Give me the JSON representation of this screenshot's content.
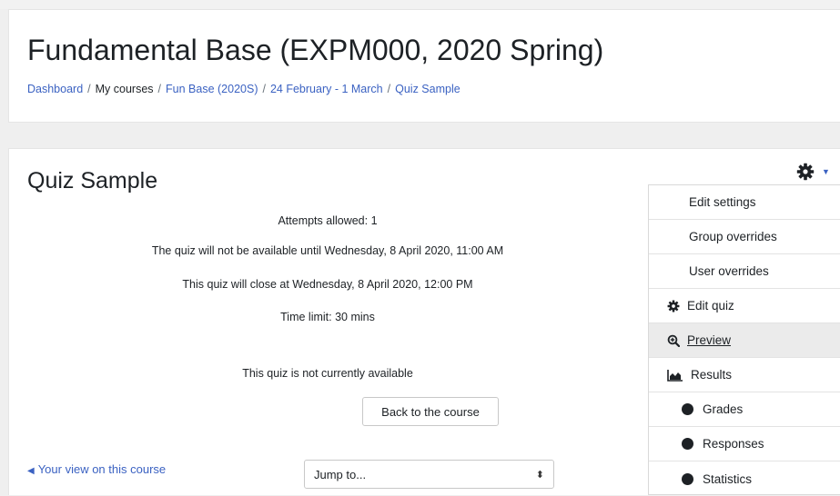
{
  "course": {
    "title": "Fundamental Base (EXPM000, 2020 Spring)",
    "breadcrumb": [
      "Dashboard",
      "My courses",
      "Fun Base (2020S)",
      "24 February - 1 March",
      "Quiz Sample"
    ]
  },
  "quiz": {
    "title": "Quiz Sample",
    "attempts": "Attempts allowed: 1",
    "open_text": "The quiz will not be available until Wednesday, 8 April 2020, 11:00 AM",
    "close_text": "This quiz will close at Wednesday, 8 April 2020, 12:00 PM",
    "time_limit": "Time limit: 30 mins",
    "availability": "This quiz is not currently available",
    "back_button": "Back to the course"
  },
  "footer": {
    "view_link": "Your view on this course",
    "jump_placeholder": "Jump to..."
  },
  "menu": {
    "items": [
      {
        "label": "Edit settings"
      },
      {
        "label": "Group overrides"
      },
      {
        "label": "User overrides"
      },
      {
        "label": "Edit quiz",
        "icon": "gear-icon"
      },
      {
        "label": "Preview",
        "icon": "zoom-in-icon"
      },
      {
        "label": "Results",
        "icon": "area-chart-icon"
      },
      {
        "label": "Grades",
        "icon": "bullet-icon"
      },
      {
        "label": "Responses",
        "icon": "bullet-icon"
      },
      {
        "label": "Statistics",
        "icon": "bullet-icon"
      }
    ]
  },
  "colors": {
    "link": "#3b62c2",
    "text": "#1d2125",
    "page_bg": "#efefef",
    "active_menu_bg": "#ebebeb"
  }
}
